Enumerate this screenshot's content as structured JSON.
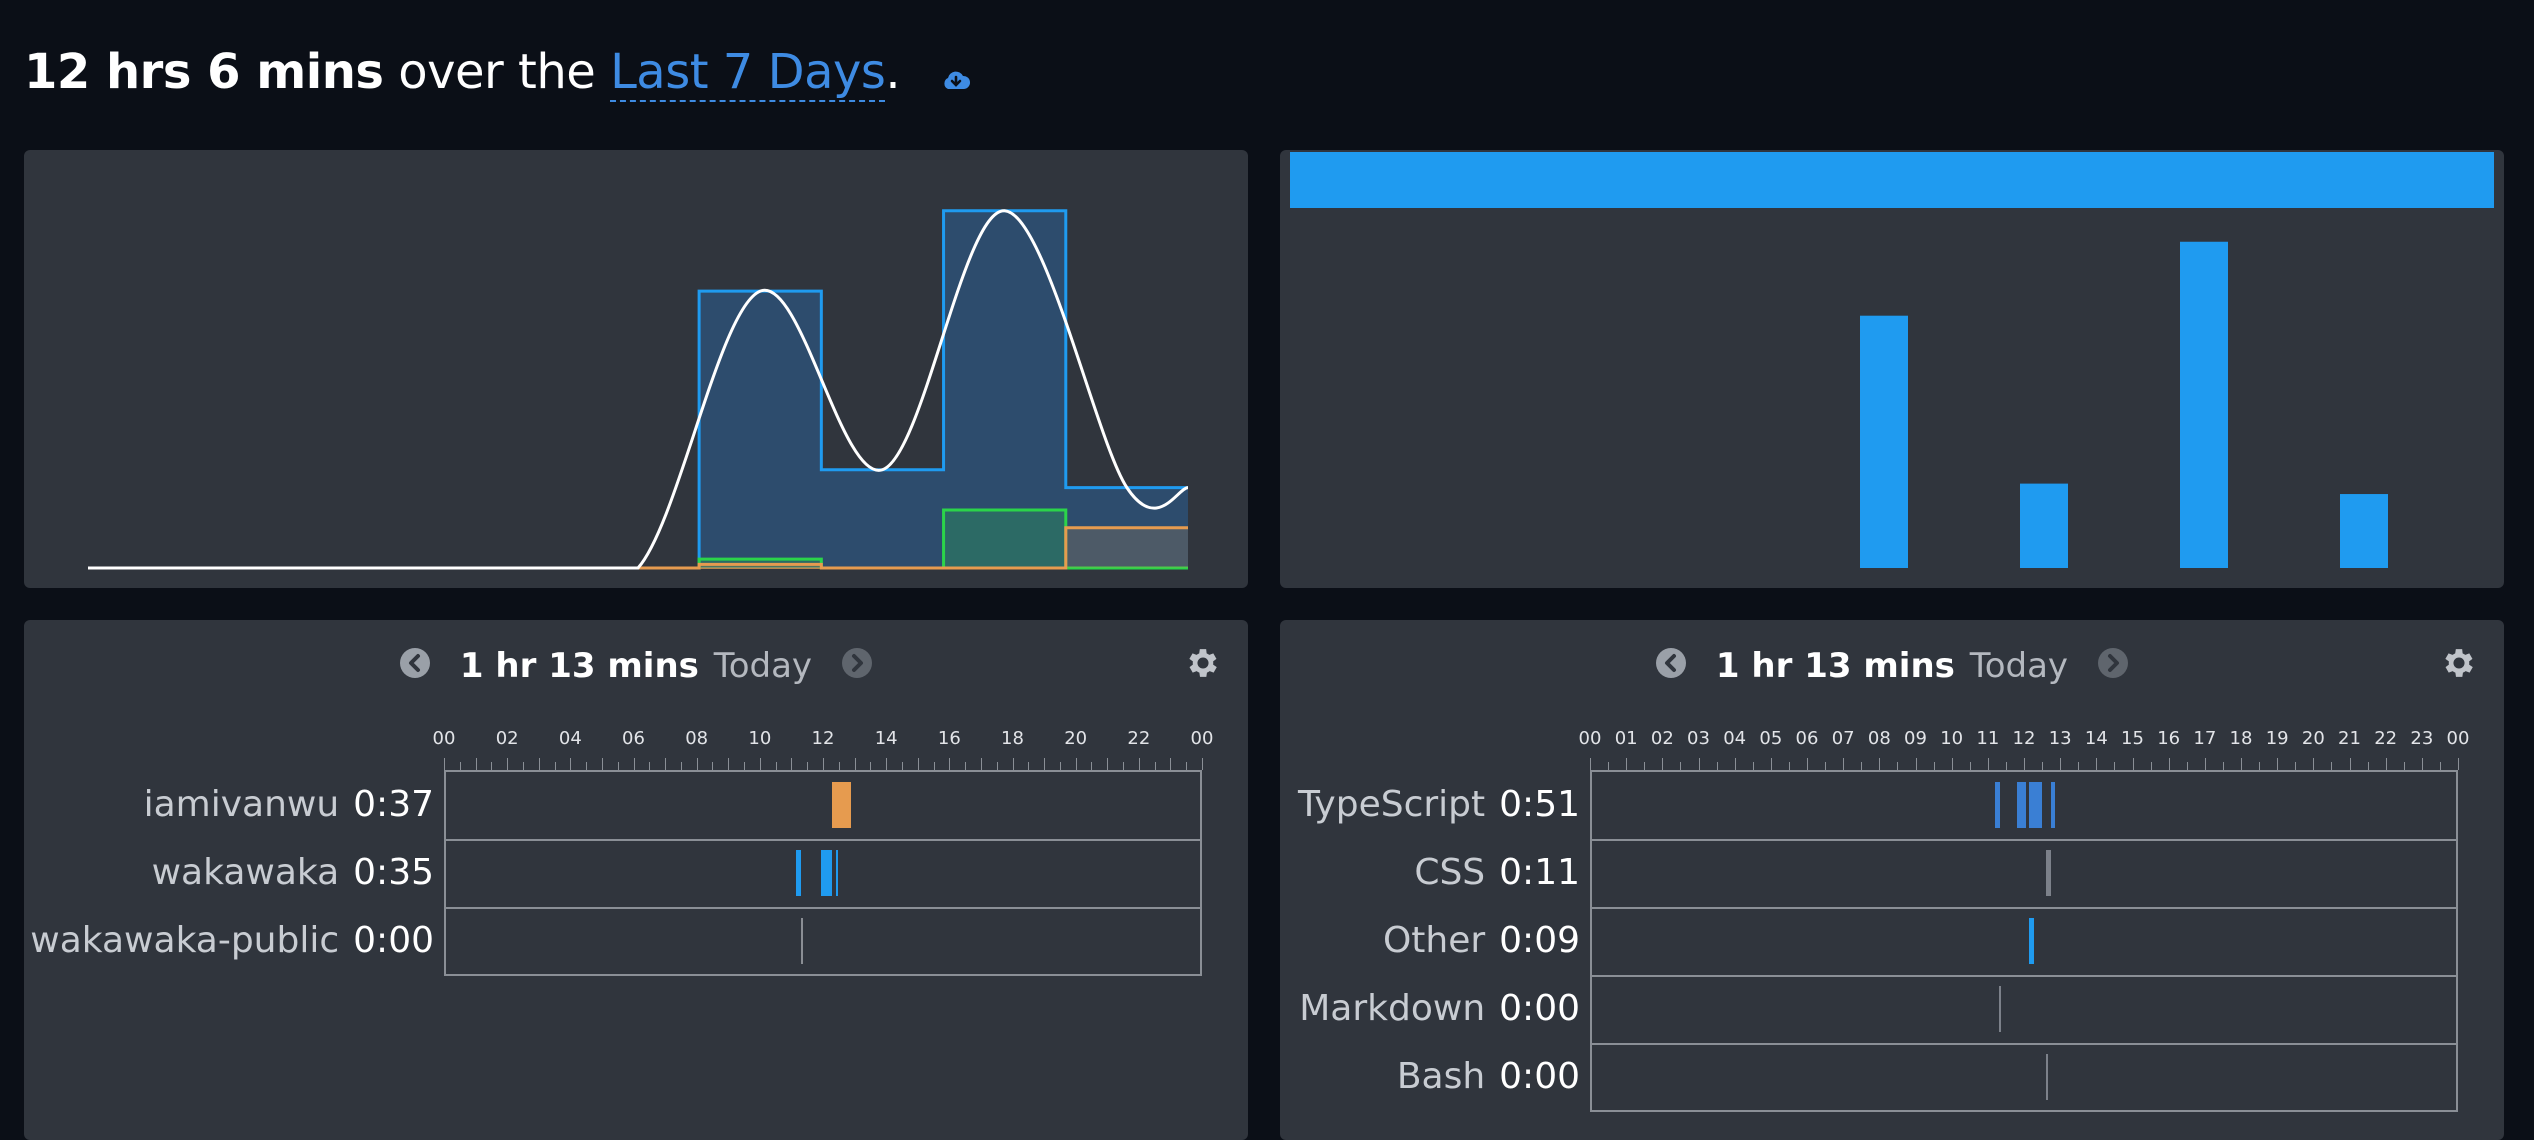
{
  "header": {
    "total": "12 hrs 6 mins",
    "connector": "over the",
    "range": "Last 7 Days",
    "period": "."
  },
  "colors": {
    "blue": "#1f9bf0",
    "green": "#2bd44a",
    "orange": "#e69b4f",
    "gray": "#8a8e94",
    "curve": "#ffffff"
  },
  "chart_data": [
    {
      "type": "area",
      "series": [
        {
          "color": "#1f9bf0",
          "values": [
            0,
            0,
            0,
            0,
            0,
            3.1,
            1.1,
            4.0,
            0.9
          ]
        },
        {
          "color": "#2bd44a",
          "values": [
            0,
            0,
            0,
            0,
            0,
            0.1,
            0,
            0.65,
            0
          ]
        },
        {
          "color": "#e69b4f",
          "values": [
            0,
            0,
            0,
            0,
            0,
            0.04,
            0,
            0,
            0.45
          ]
        }
      ],
      "ylim": [
        0,
        4.4
      ]
    },
    {
      "type": "bar",
      "values": [
        0,
        0,
        0,
        0,
        2.9,
        0.97,
        3.75,
        0.85
      ],
      "color": "#1f9bf0",
      "total_bar_fraction": 1.0,
      "ylim": [
        0,
        4.0
      ]
    }
  ],
  "projects_timeline": {
    "duration": "1 hr 13 mins",
    "day": "Today",
    "ticks": [
      "00",
      "02",
      "04",
      "06",
      "08",
      "10",
      "12",
      "14",
      "16",
      "18",
      "20",
      "22",
      "00"
    ],
    "rows": [
      {
        "name": "iamivanwu",
        "time": "0:37",
        "color": "#e69b4f",
        "segments": [
          [
            12.3,
            12.9
          ]
        ]
      },
      {
        "name": "wakawaka",
        "time": "0:35",
        "color": "#1f9bf0",
        "segments": [
          [
            11.15,
            11.3
          ],
          [
            11.95,
            12.3
          ],
          [
            12.4,
            12.48
          ]
        ]
      },
      {
        "name": "wakawaka-public",
        "time": "0:00",
        "color": "#8a8e94",
        "segments": [
          [
            11.3,
            11.35
          ]
        ]
      }
    ]
  },
  "languages_timeline": {
    "duration": "1 hr 13 mins",
    "day": "Today",
    "ticks": [
      "00",
      "01",
      "02",
      "03",
      "04",
      "05",
      "06",
      "07",
      "08",
      "09",
      "10",
      "11",
      "12",
      "13",
      "14",
      "15",
      "16",
      "17",
      "18",
      "19",
      "20",
      "21",
      "22",
      "23",
      "00"
    ],
    "rows": [
      {
        "name": "TypeScript",
        "time": "0:51",
        "color": "#3a7fd4",
        "segments": [
          [
            11.2,
            11.35
          ],
          [
            11.8,
            12.05
          ],
          [
            12.15,
            12.5
          ],
          [
            12.75,
            12.85
          ]
        ]
      },
      {
        "name": "CSS",
        "time": "0:11",
        "color": "#7c818a",
        "segments": [
          [
            12.6,
            12.75
          ]
        ]
      },
      {
        "name": "Other",
        "time": "0:09",
        "color": "#1f9bf0",
        "segments": [
          [
            12.15,
            12.28
          ]
        ]
      },
      {
        "name": "Markdown",
        "time": "0:00",
        "color": "#7c818a",
        "segments": [
          [
            11.3,
            11.34
          ]
        ]
      },
      {
        "name": "Bash",
        "time": "0:00",
        "color": "#7c818a",
        "segments": [
          [
            12.6,
            12.64
          ]
        ]
      }
    ]
  }
}
